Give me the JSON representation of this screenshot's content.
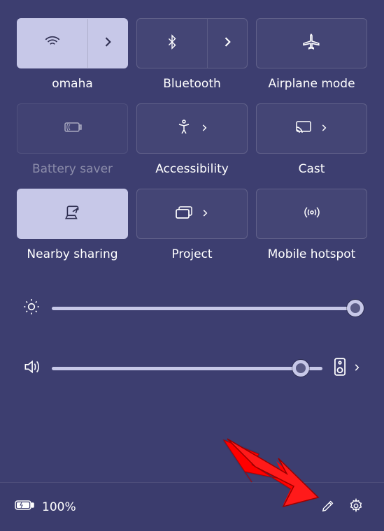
{
  "tiles": [
    {
      "id": "wifi",
      "label": "omaha",
      "icon": "wifi-icon",
      "active": true,
      "split": true,
      "disabled": false
    },
    {
      "id": "bluetooth",
      "label": "Bluetooth",
      "icon": "bluetooth-icon",
      "active": false,
      "split": true,
      "disabled": false
    },
    {
      "id": "airplane",
      "label": "Airplane mode",
      "icon": "airplane-icon",
      "active": false,
      "split": false,
      "disabled": false
    },
    {
      "id": "battery-saver",
      "label": "Battery saver",
      "icon": "battery-saver-icon",
      "active": false,
      "split": false,
      "disabled": true
    },
    {
      "id": "accessibility",
      "label": "Accessibility",
      "icon": "accessibility-icon",
      "active": false,
      "split": false,
      "chevron": true,
      "disabled": false
    },
    {
      "id": "cast",
      "label": "Cast",
      "icon": "cast-icon",
      "active": false,
      "split": false,
      "chevron": true,
      "disabled": false
    },
    {
      "id": "nearby-sharing",
      "label": "Nearby sharing",
      "icon": "nearby-sharing-icon",
      "active": true,
      "split": false,
      "disabled": false
    },
    {
      "id": "project",
      "label": "Project",
      "icon": "project-icon",
      "active": false,
      "split": false,
      "chevron": true,
      "disabled": false
    },
    {
      "id": "hotspot",
      "label": "Mobile hotspot",
      "icon": "hotspot-icon",
      "active": false,
      "split": false,
      "disabled": false
    }
  ],
  "sliders": {
    "brightness": {
      "value": 98
    },
    "volume": {
      "value": 92
    }
  },
  "footer": {
    "battery_percent": "100%"
  }
}
